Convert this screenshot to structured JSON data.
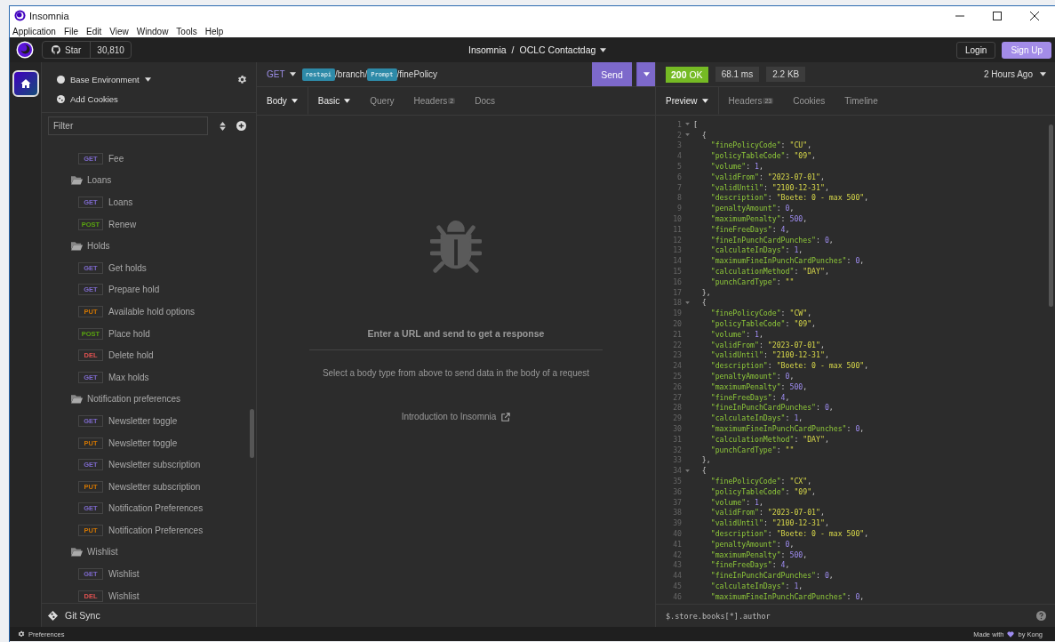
{
  "window": {
    "title": "Insomnia",
    "menu": [
      "Application",
      "File",
      "Edit",
      "View",
      "Window",
      "Tools",
      "Help"
    ]
  },
  "header": {
    "star_label": "Star",
    "star_count": "30,810",
    "breadcrumb": [
      "Insomnia",
      "OCLC Contactdag"
    ],
    "separator": "/",
    "login": "Login",
    "signup": "Sign Up"
  },
  "sidebar": {
    "environment": "Base Environment",
    "cookies": "Add Cookies",
    "filter": {
      "placeholder": "Filter"
    },
    "tree": [
      {
        "kind": "request",
        "method": "GET",
        "color": "#7d69cb",
        "name": "Fee"
      },
      {
        "kind": "folder",
        "name": "Loans",
        "children": [
          {
            "kind": "request",
            "method": "GET",
            "color": "#7d69cb",
            "name": "Loans"
          },
          {
            "kind": "request",
            "method": "POST",
            "color": "#59a210",
            "name": "Renew"
          }
        ]
      },
      {
        "kind": "folder",
        "name": "Holds",
        "children": [
          {
            "kind": "request",
            "method": "GET",
            "color": "#7d69cb",
            "name": "Get holds"
          },
          {
            "kind": "request",
            "method": "GET",
            "color": "#7d69cb",
            "name": "Prepare hold"
          },
          {
            "kind": "request",
            "method": "PUT",
            "color": "#d07502",
            "name": "Available hold options"
          },
          {
            "kind": "request",
            "method": "POST",
            "color": "#59a210",
            "name": "Place hold"
          },
          {
            "kind": "request",
            "method": "DEL",
            "color": "#e15251",
            "name": "Delete hold"
          },
          {
            "kind": "request",
            "method": "GET",
            "color": "#7d69cb",
            "name": "Max holds"
          }
        ]
      },
      {
        "kind": "folder",
        "name": "Notification preferences",
        "children": [
          {
            "kind": "request",
            "method": "GET",
            "color": "#7d69cb",
            "name": "Newsletter toggle"
          },
          {
            "kind": "request",
            "method": "PUT",
            "color": "#d07502",
            "name": "Newsletter toggle"
          },
          {
            "kind": "request",
            "method": "GET",
            "color": "#7d69cb",
            "name": "Newsletter subscription"
          },
          {
            "kind": "request",
            "method": "PUT",
            "color": "#d07502",
            "name": "Newsletter subscription"
          },
          {
            "kind": "request",
            "method": "GET",
            "color": "#7d69cb",
            "name": "Notification Preferences"
          },
          {
            "kind": "request",
            "method": "PUT",
            "color": "#d07502",
            "name": "Notification Preferences"
          }
        ]
      },
      {
        "kind": "folder",
        "name": "Wishlist",
        "children": [
          {
            "kind": "request",
            "method": "GET",
            "color": "#7d69cb",
            "name": "Wishlist"
          },
          {
            "kind": "request",
            "method": "DEL",
            "color": "#e15251",
            "name": "Wishlist"
          }
        ]
      }
    ],
    "git_sync": "Git Sync"
  },
  "request": {
    "method": "GET",
    "url": [
      {
        "kind": "tag",
        "text": "restapi"
      },
      {
        "kind": "text",
        "text": "/branch/"
      },
      {
        "kind": "tag",
        "text": "Prompt"
      },
      {
        "kind": "text",
        "text": "/finePolicy"
      }
    ],
    "send": "Send",
    "tabs": [
      {
        "label": "Body",
        "selected": true,
        "dropdown": true
      },
      {
        "label": "Basic",
        "selected": false,
        "dropdown": true
      },
      {
        "label": "Query",
        "selected": false
      },
      {
        "label": "Headers",
        "selected": false,
        "badge": "2"
      },
      {
        "label": "Docs",
        "selected": false
      }
    ],
    "empty": {
      "title": "Enter a URL and send to get a response",
      "hint": "Select a body type from above to send data in the body of a request",
      "link": "Introduction to Insomnia"
    }
  },
  "response": {
    "status": {
      "code": "200",
      "text": "OK"
    },
    "time": "68.1 ms",
    "size": "2.2 KB",
    "history": "2 Hours Ago",
    "tabs": [
      {
        "label": "Preview",
        "selected": true,
        "dropdown": true
      },
      {
        "label": "Headers",
        "selected": false,
        "badge": "23"
      },
      {
        "label": "Cookies",
        "selected": false
      },
      {
        "label": "Timeline",
        "selected": false
      }
    ],
    "lines": [
      {
        "n": "1",
        "fold": true,
        "text": "["
      },
      {
        "n": "2",
        "fold": true,
        "text": "  {"
      },
      {
        "n": "3",
        "text": "    \"finePolicyCode\": \"CU\","
      },
      {
        "n": "4",
        "text": "    \"policyTableCode\": \"09\","
      },
      {
        "n": "5",
        "text": "    \"volume\": 1,"
      },
      {
        "n": "6",
        "text": "    \"validFrom\": \"2023-07-01\","
      },
      {
        "n": "7",
        "text": "    \"validUntil\": \"2100-12-31\","
      },
      {
        "n": "8",
        "text": "    \"description\": \"Boete: 0 - max 500\","
      },
      {
        "n": "9",
        "text": "    \"penaltyAmount\": 0,"
      },
      {
        "n": "10",
        "text": "    \"maximumPenalty\": 500,"
      },
      {
        "n": "11",
        "text": "    \"fineFreeDays\": 4,"
      },
      {
        "n": "12",
        "text": "    \"fineInPunchCardPunches\": 0,"
      },
      {
        "n": "13",
        "text": "    \"calculateInDays\": 1,"
      },
      {
        "n": "14",
        "text": "    \"maximumFineInPunchCardPunches\": 0,"
      },
      {
        "n": "15",
        "text": "    \"calculationMethod\": \"DAY\","
      },
      {
        "n": "16",
        "text": "    \"punchCardType\": \"\""
      },
      {
        "n": "17",
        "text": "  },"
      },
      {
        "n": "18",
        "fold": true,
        "text": "  {"
      },
      {
        "n": "19",
        "text": "    \"finePolicyCode\": \"CW\","
      },
      {
        "n": "20",
        "text": "    \"policyTableCode\": \"09\","
      },
      {
        "n": "21",
        "text": "    \"volume\": 1,"
      },
      {
        "n": "22",
        "text": "    \"validFrom\": \"2023-07-01\","
      },
      {
        "n": "23",
        "text": "    \"validUntil\": \"2100-12-31\","
      },
      {
        "n": "24",
        "text": "    \"description\": \"Boete: 0 - max 500\","
      },
      {
        "n": "25",
        "text": "    \"penaltyAmount\": 0,"
      },
      {
        "n": "26",
        "text": "    \"maximumPenalty\": 500,"
      },
      {
        "n": "27",
        "text": "    \"fineFreeDays\": 4,"
      },
      {
        "n": "28",
        "text": "    \"fineInPunchCardPunches\": 0,"
      },
      {
        "n": "29",
        "text": "    \"calculateInDays\": 1,"
      },
      {
        "n": "30",
        "text": "    \"maximumFineInPunchCardPunches\": 0,"
      },
      {
        "n": "31",
        "text": "    \"calculationMethod\": \"DAY\","
      },
      {
        "n": "32",
        "text": "    \"punchCardType\": \"\""
      },
      {
        "n": "33",
        "text": "  },"
      },
      {
        "n": "34",
        "fold": true,
        "text": "  {"
      },
      {
        "n": "35",
        "text": "    \"finePolicyCode\": \"CX\","
      },
      {
        "n": "36",
        "text": "    \"policyTableCode\": \"09\","
      },
      {
        "n": "37",
        "text": "    \"volume\": 1,"
      },
      {
        "n": "38",
        "text": "    \"validFrom\": \"2023-07-01\","
      },
      {
        "n": "39",
        "text": "    \"validUntil\": \"2100-12-31\","
      },
      {
        "n": "40",
        "text": "    \"description\": \"Boete: 0 - max 500\","
      },
      {
        "n": "41",
        "text": "    \"penaltyAmount\": 0,"
      },
      {
        "n": "42",
        "text": "    \"maximumPenalty\": 500,"
      },
      {
        "n": "43",
        "text": "    \"fineFreeDays\": 4,"
      },
      {
        "n": "44",
        "text": "    \"fineInPunchCardPunches\": 0,"
      },
      {
        "n": "45",
        "text": "    \"calculateInDays\": 1,"
      },
      {
        "n": "46",
        "text": "    \"maximumFineInPunchCardPunches\": 0,"
      }
    ],
    "filter": {
      "placeholder": "$.store.books[*].author"
    }
  },
  "status_bar": {
    "preferences": "Preferences",
    "made_with": "Made with",
    "by": "by Kong"
  }
}
